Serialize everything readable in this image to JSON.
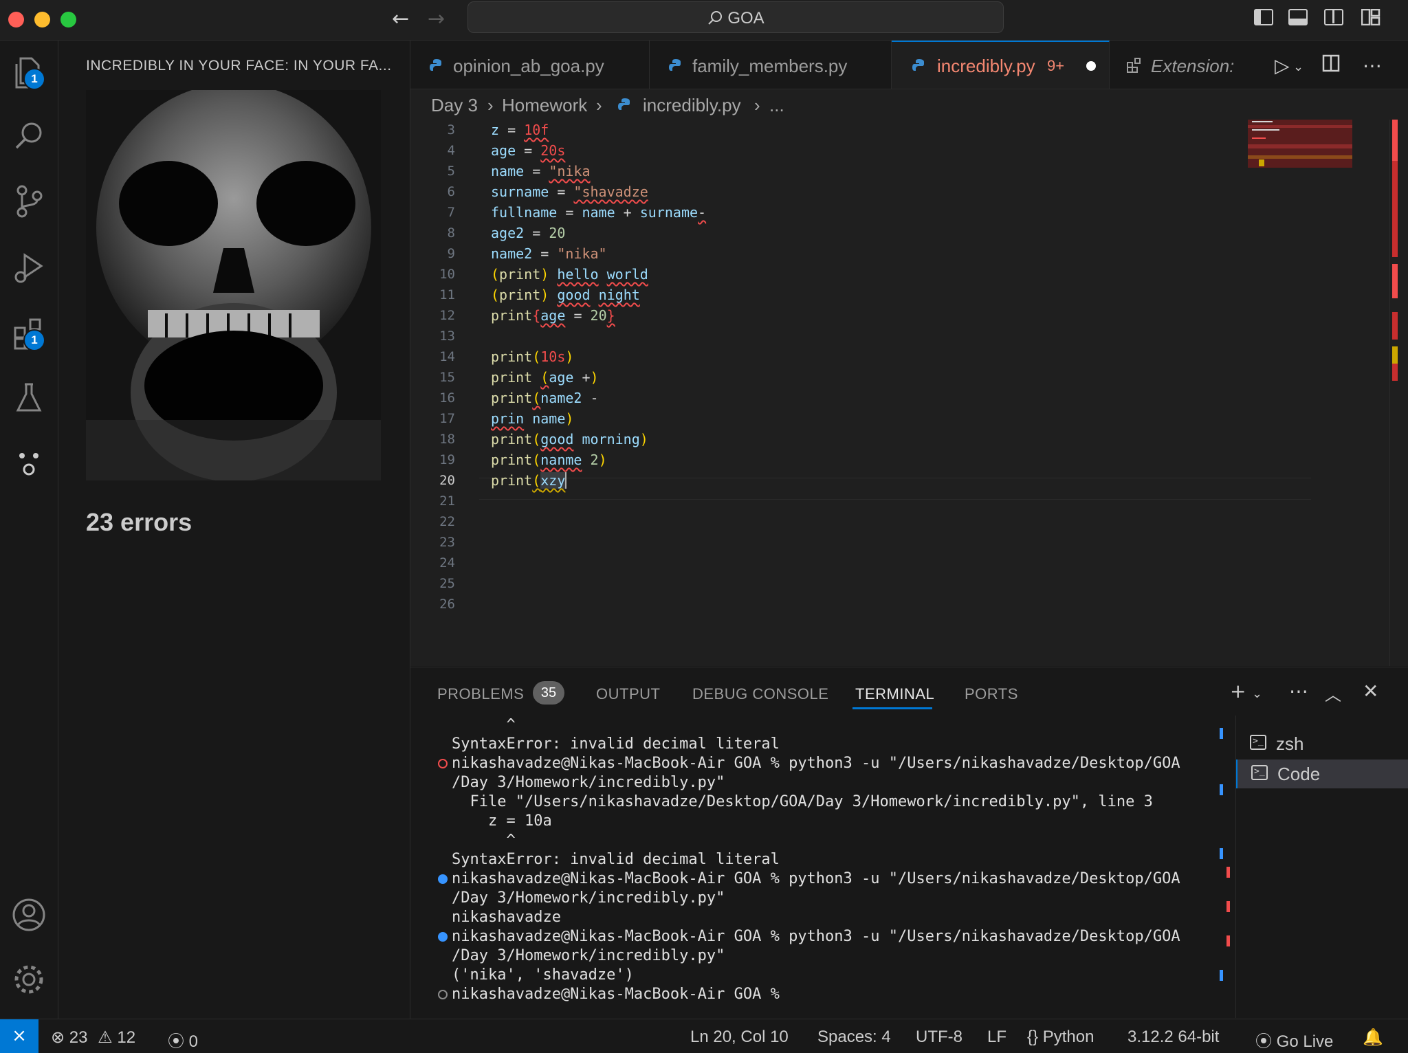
{
  "titlebar": {
    "search": "GOA",
    "colors": {
      "close": "#ff5f57",
      "minimize": "#febc2e",
      "maximize": "#28c840"
    }
  },
  "activity": {
    "explorer_badge": "1",
    "extensions_badge": "1"
  },
  "sidebar": {
    "title": "INCREDIBLY IN YOUR FACE: IN YOUR FA...",
    "errors": "23 errors"
  },
  "tabs": [
    {
      "label": "opinion_ab_goa.py"
    },
    {
      "label": "family_members.py"
    },
    {
      "label": "incredibly.py",
      "problems": "9+"
    },
    {
      "label": "Extension: I"
    }
  ],
  "breadcrumb": [
    "Day 3",
    "Homework",
    "incredibly.py",
    "..."
  ],
  "editor": {
    "line_numbers": [
      "3",
      "4",
      "5",
      "6",
      "7",
      "8",
      "9",
      "10",
      "11",
      "12",
      "13",
      "14",
      "15",
      "16",
      "17",
      "18",
      "19",
      "20",
      "21",
      "22",
      "23",
      "24",
      "25",
      "26"
    ],
    "current_line": "20"
  },
  "panel": {
    "tabs": [
      "PROBLEMS",
      "OUTPUT",
      "DEBUG CONSOLE",
      "TERMINAL",
      "PORTS"
    ],
    "problems_count": "35",
    "terminal_lines": [
      "      ^",
      "SyntaxError: invalid decimal literal",
      "nikashavadze@Nikas-MacBook-Air GOA % python3 -u \"/Users/nikashavadze/Desktop/GOA",
      "/Day 3/Homework/incredibly.py\"",
      "  File \"/Users/nikashavadze/Desktop/GOA/Day 3/Homework/incredibly.py\", line 3",
      "    z = 10a",
      "      ^",
      "SyntaxError: invalid decimal literal",
      "nikashavadze@Nikas-MacBook-Air GOA % python3 -u \"/Users/nikashavadze/Desktop/GOA",
      "/Day 3/Homework/incredibly.py\"",
      "nikashavadze",
      "nikashavadze@Nikas-MacBook-Air GOA % python3 -u \"/Users/nikashavadze/Desktop/GOA",
      "/Day 3/Homework/incredibly.py\"",
      "('nika', 'shavadze')",
      "nikashavadze@Nikas-MacBook-Air GOA %"
    ],
    "terminals": [
      "zsh",
      "Code"
    ]
  },
  "status": {
    "errors": "23",
    "warnings": "12",
    "ports": "0",
    "position": "Ln 20, Col 10",
    "spaces": "Spaces: 4",
    "encoding": "UTF-8",
    "eol": "LF",
    "language": "Python",
    "interpreter": "3.12.2 64-bit",
    "golive": "Go Live"
  }
}
